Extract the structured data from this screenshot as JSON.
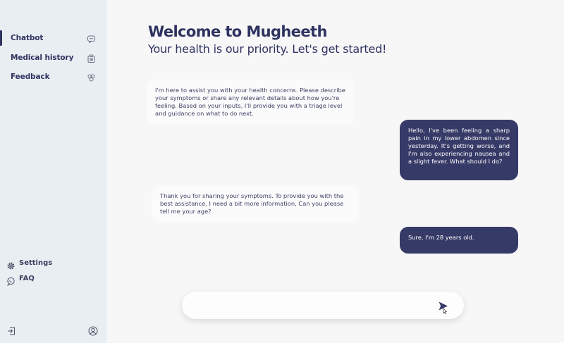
{
  "sidebar": {
    "items": [
      {
        "label": "Chatbot",
        "icon": "chat-icon"
      },
      {
        "label": "Medical history",
        "icon": "medical-record-icon"
      },
      {
        "label": "Feedback",
        "icon": "feedback-icon"
      }
    ],
    "bottom": [
      {
        "label": "Settings",
        "icon": "gear-icon"
      },
      {
        "label": "FAQ",
        "icon": "faq-icon"
      }
    ],
    "logout_icon": "logout-icon",
    "profile_icon": "user-profile-icon"
  },
  "header": {
    "title": "Welcome to Mugheeth",
    "subtitle": "Your health is our priority. Let's get started!"
  },
  "messages": [
    {
      "from": "bot",
      "text": "I'm here to assist you with your health concerns. Please describe your symptoms or share any relevant details about how you're feeling. Based on your inputs, I'll provide you with a triage level and guidance on what to do next."
    },
    {
      "from": "user",
      "text": "Hello, I've been feeling a sharp pain in my lower abdomen since yesterday. It's getting worse, and I'm also experiencing nausea and a slight fever. What should I do?"
    },
    {
      "from": "bot",
      "text": "Thank you for sharing your symptoms. To provide you with the best assistance, I need a bit more information,  Can you please tell me your age?"
    },
    {
      "from": "user",
      "text": "Sure, I'm 28 years old."
    }
  ],
  "composer": {
    "value": "",
    "send_icon": "send-icon"
  },
  "colors": {
    "primary": "#363a67",
    "sidebar_bg": "#e9eef2",
    "page_bg": "#f7f7f8"
  }
}
